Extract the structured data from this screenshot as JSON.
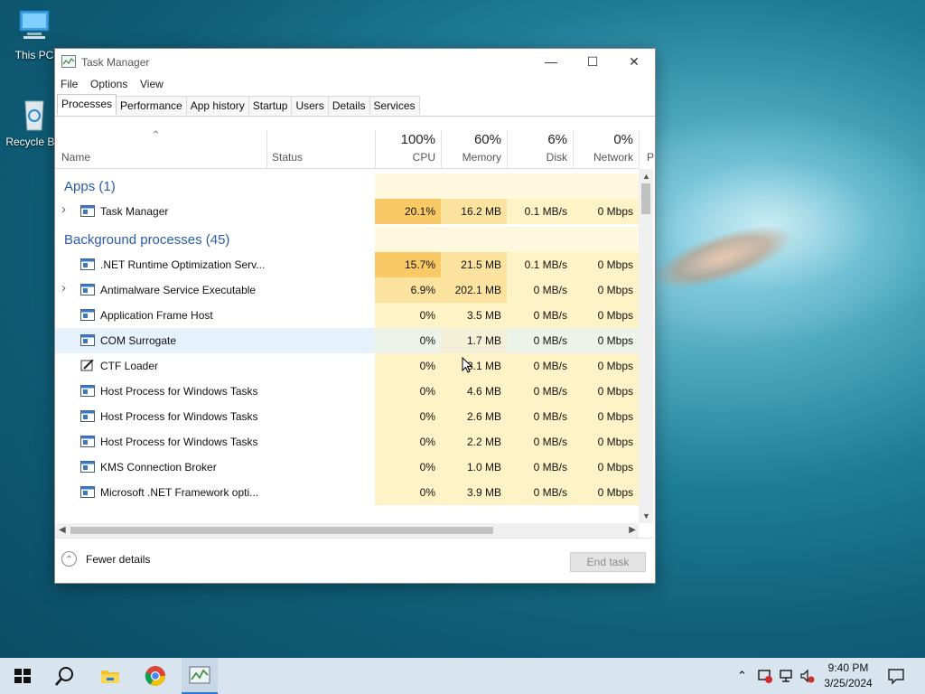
{
  "desktop": {
    "icons": [
      {
        "label": "This PC"
      },
      {
        "label": "Recycle Bin"
      }
    ]
  },
  "window": {
    "title": "Task Manager",
    "controls": {
      "minimize": "—",
      "maximize": "☐",
      "close": "✕"
    },
    "menu": [
      "File",
      "Options",
      "View"
    ],
    "tabs": [
      "Processes",
      "Performance",
      "App history",
      "Startup",
      "Users",
      "Details",
      "Services"
    ],
    "active_tab": "Processes",
    "columns": {
      "name": "Name",
      "status": "Status",
      "cpu": {
        "pct": "100%",
        "label": "CPU"
      },
      "memory": {
        "pct": "60%",
        "label": "Memory"
      },
      "disk": {
        "pct": "6%",
        "label": "Disk"
      },
      "network": {
        "pct": "0%",
        "label": "Network"
      },
      "power_partial": "P"
    },
    "groups": [
      {
        "label": "Apps (1)"
      },
      {
        "label": "Background processes (45)"
      }
    ],
    "apps": [
      {
        "name": "Task Manager",
        "cpu": "20.1%",
        "memory": "16.2 MB",
        "disk": "0.1 MB/s",
        "network": "0 Mbps",
        "expand": true
      }
    ],
    "background": [
      {
        "name": ".NET Runtime Optimization Serv...",
        "cpu": "15.7%",
        "memory": "21.5 MB",
        "disk": "0.1 MB/s",
        "network": "0 Mbps",
        "expand": false
      },
      {
        "name": "Antimalware Service Executable",
        "cpu": "6.9%",
        "memory": "202.1 MB",
        "disk": "0 MB/s",
        "network": "0 Mbps",
        "expand": true
      },
      {
        "name": "Application Frame Host",
        "cpu": "0%",
        "memory": "3.5 MB",
        "disk": "0 MB/s",
        "network": "0 Mbps",
        "expand": false
      },
      {
        "name": "COM Surrogate",
        "cpu": "0%",
        "memory": "1.7 MB",
        "disk": "0 MB/s",
        "network": "0 Mbps",
        "expand": false
      },
      {
        "name": "CTF Loader",
        "cpu": "0%",
        "memory": "3.1 MB",
        "disk": "0 MB/s",
        "network": "0 Mbps",
        "expand": false
      },
      {
        "name": "Host Process for Windows Tasks",
        "cpu": "0%",
        "memory": "4.6 MB",
        "disk": "0 MB/s",
        "network": "0 Mbps",
        "expand": false
      },
      {
        "name": "Host Process for Windows Tasks",
        "cpu": "0%",
        "memory": "2.6 MB",
        "disk": "0 MB/s",
        "network": "0 Mbps",
        "expand": false
      },
      {
        "name": "Host Process for Windows Tasks",
        "cpu": "0%",
        "memory": "2.2 MB",
        "disk": "0 MB/s",
        "network": "0 Mbps",
        "expand": false
      },
      {
        "name": "KMS Connection Broker",
        "cpu": "0%",
        "memory": "1.0 MB",
        "disk": "0 MB/s",
        "network": "0 Mbps",
        "expand": false
      },
      {
        "name": "Microsoft .NET Framework opti...",
        "cpu": "0%",
        "memory": "3.9 MB",
        "disk": "0 MB/s",
        "network": "0 Mbps",
        "expand": false
      }
    ],
    "fewer_details": "Fewer details",
    "end_task": "End task"
  },
  "colors": {
    "group_text": "#2a5ca8",
    "heat_high": "#f9c965",
    "heat_mid": "#fbe39f",
    "heat_low": "#fdf3c6",
    "heat_faint": "#fef8de",
    "hover_row": "#e5f1fb"
  },
  "taskbar": {
    "time": "9:40 PM",
    "date": "3/25/2024"
  }
}
